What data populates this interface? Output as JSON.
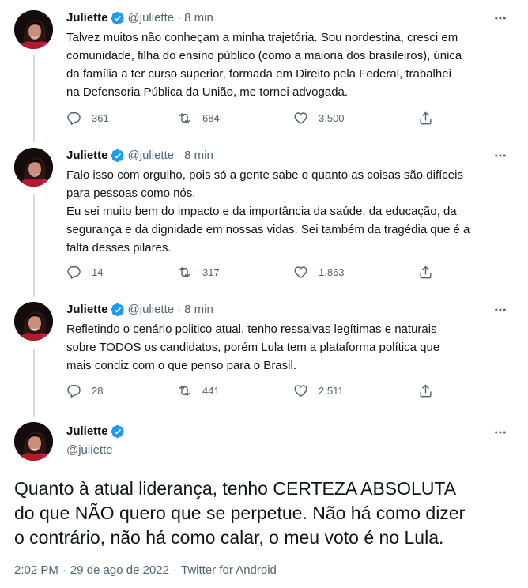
{
  "author": {
    "name": "Juliette",
    "handle": "@juliette"
  },
  "tweets": [
    {
      "time": "8 min",
      "text": "Talvez muitos não conheçam a minha trajetória. Sou nordestina, cresci em\ncomunidade, filha do ensino público (como a maioria dos brasileiros), única\nda família a ter curso superior, formada em Direito pela Federal, trabalhei\nna Defensoria Pública da União, me tornei advogada.",
      "replies": "361",
      "retweets": "684",
      "likes": "3.500"
    },
    {
      "time": "8 min",
      "text": "Falo isso com orgulho, pois só a gente sabe o quanto as coisas são difíceis\npara pessoas como nós.\nEu sei muito bem do impacto e da importância da saúde, da educação, da\nsegurança e da dignidade em nossas vidas. Sei também da tragédia que é a\nfalta desses pilares.",
      "replies": "14",
      "retweets": "317",
      "likes": "1.863"
    },
    {
      "time": "8 min",
      "text": "Refletindo o cenário politico atual, tenho ressalvas legítimas e naturais\nsobre TODOS os candidatos, porém Lula tem a plataforma política que\nmais condiz com o que penso para o Brasil.",
      "replies": "28",
      "retweets": "441",
      "likes": "2.511"
    }
  ],
  "main_tweet": {
    "text": "Quanto à atual liderança, tenho CERTEZA ABSOLUTA\ndo que NÃO quero que se perpetue. Não há como dizer\no contrário, não há como calar, o meu voto é no Lula.",
    "time": "2:02 PM",
    "date": "29 de ago de 2022",
    "source": "Twitter for Android"
  },
  "colors": {
    "text": "#0f1419",
    "secondary": "#536471",
    "verified": "#1d9bf0",
    "thread_line": "#cfd9de"
  },
  "icons": [
    "verified-badge-icon",
    "more-icon",
    "reply-icon",
    "retweet-icon",
    "like-icon",
    "share-icon"
  ]
}
